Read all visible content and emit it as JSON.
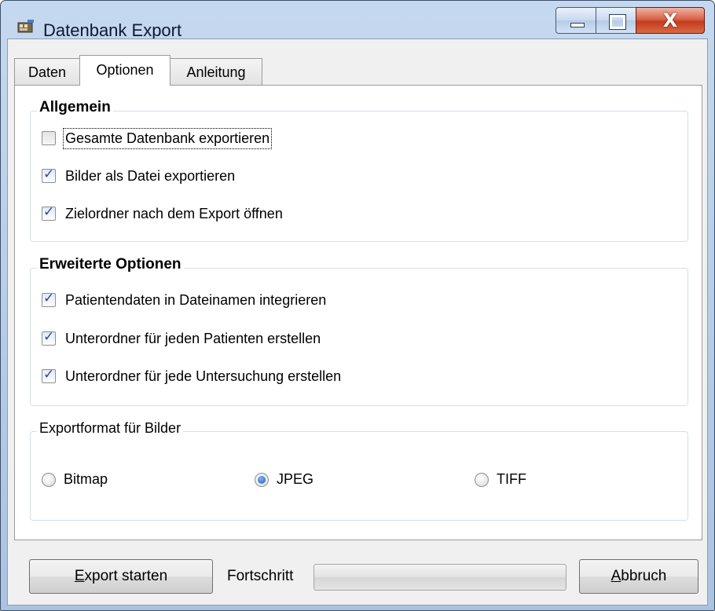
{
  "window": {
    "title": "Datenbank Export",
    "close_label": "X"
  },
  "tabs": [
    {
      "label": "Daten",
      "active": false
    },
    {
      "label": "Optionen",
      "active": true
    },
    {
      "label": "Anleitung",
      "active": false
    }
  ],
  "groups": {
    "allgemein": {
      "title": "Allgemein",
      "options": [
        {
          "label": "Gesamte Datenbank exportieren",
          "checked": false
        },
        {
          "label": "Bilder als Datei exportieren",
          "checked": true
        },
        {
          "label": "Zielordner nach dem Export öffnen",
          "checked": true
        }
      ]
    },
    "erweitert": {
      "title": "Erweiterte Optionen",
      "options": [
        {
          "label": "Patientendaten in Dateinamen integrieren",
          "checked": true
        },
        {
          "label": "Unterordner für jeden Patienten erstellen",
          "checked": true
        },
        {
          "label": "Unterordner für jede Untersuchung erstellen",
          "checked": true
        }
      ]
    },
    "format": {
      "title": "Exportformat für Bilder",
      "options": [
        {
          "label": "Bitmap",
          "selected": false
        },
        {
          "label": "JPEG",
          "selected": true
        },
        {
          "label": "TIFF",
          "selected": false
        }
      ]
    }
  },
  "footer": {
    "export_button": {
      "mnemonic": "E",
      "rest": "xport starten"
    },
    "progress_label": "Fortschritt",
    "progress_value": 0,
    "cancel_button": {
      "mnemonic": "A",
      "rest": "bbruch"
    }
  },
  "colors": {
    "accent_check": "#2c4a9a",
    "titlebar": "#b4cbe7",
    "close_button": "#c23c1e"
  }
}
